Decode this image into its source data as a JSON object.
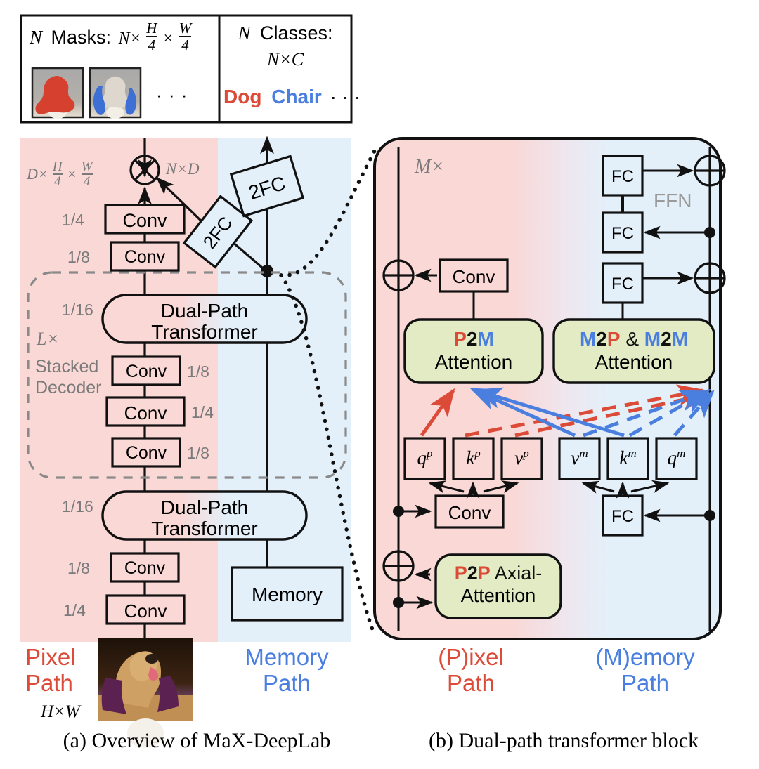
{
  "figure": {
    "captions": [
      {
        "id": "a",
        "text": "(a)  Overview of MaX-DeepLab"
      },
      {
        "id": "b",
        "text": "(b)  Dual-path transformer block"
      }
    ]
  },
  "colors": {
    "pixel_red": "#DC4A38",
    "memory_blue": "#4A7FE0",
    "pixel_bg": "#F9D8D6",
    "memory_bg": "#E3F0FA",
    "attention_green": "#E2EBC4",
    "gray_label": "#808080",
    "outline": "#111111"
  },
  "output_panel": {
    "masks": {
      "title_n": "N",
      "title_text": "Masks:",
      "shape_prefix": "N×",
      "frac1_num": "H",
      "frac1_den": "4",
      "times": "×",
      "frac2_num": "W",
      "frac2_den": "4",
      "ellipsis": "· · ·",
      "thumbs": [
        {
          "name": "mask-thumb-dog",
          "mask_color": "#D6402E"
        },
        {
          "name": "mask-thumb-chair",
          "mask_color": "#3E6FD4"
        }
      ]
    },
    "classes": {
      "title_n": "N",
      "title_text": "Classes:",
      "shape": "N×C",
      "labels": [
        {
          "text": "Dog",
          "color": "#DC4A38"
        },
        {
          "text": "Chair",
          "color": "#4A7FE0"
        }
      ],
      "ellipsis": "· · ·"
    }
  },
  "overview": {
    "path_labels": {
      "pixel": [
        "Pixel",
        "Path"
      ],
      "memory": [
        "Memory",
        "Path"
      ],
      "input_shape": "H×W"
    },
    "output_shape_left": {
      "prefix": "D×",
      "n1": "H",
      "d1": "4",
      "mid": "×",
      "n2": "W",
      "d2": "4"
    },
    "mul_out_label": "N×D",
    "multiply_symbol": "⊗",
    "fc_blocks": [
      {
        "name": "fc-2fc-mask",
        "label": "2FC"
      },
      {
        "name": "fc-2fc-class",
        "label": "2FC"
      }
    ],
    "dashed_group": {
      "repeat": "L×",
      "line1": "Stacked",
      "line2": "Decoder"
    },
    "transformer_label": [
      "Dual-Path",
      "Transformer"
    ],
    "memory_box_label": "Memory",
    "conv_label": "Conv",
    "stages": [
      {
        "name": "conv-top-1-4",
        "label": "Conv",
        "scale": "1/4",
        "scale_side": "left"
      },
      {
        "name": "conv-top-1-8",
        "label": "Conv",
        "scale": "1/8",
        "scale_side": "left"
      },
      {
        "name": "transformer-upper",
        "label": "Dual-Path Transformer",
        "scale": "1/16",
        "scale_side": "left"
      },
      {
        "name": "conv-dec-1-8a",
        "label": "Conv",
        "scale": "1/8",
        "scale_side": "right"
      },
      {
        "name": "conv-dec-1-4",
        "label": "Conv",
        "scale": "1/4",
        "scale_side": "right"
      },
      {
        "name": "conv-dec-1-8b",
        "label": "Conv",
        "scale": "1/8",
        "scale_side": "right"
      },
      {
        "name": "transformer-lower",
        "label": "Dual-Path Transformer",
        "scale": "1/16",
        "scale_side": "left"
      },
      {
        "name": "conv-bot-1-8",
        "label": "Conv",
        "scale": "1/8",
        "scale_side": "left"
      },
      {
        "name": "conv-bot-1-4",
        "label": "Conv",
        "scale": "1/4",
        "scale_side": "left"
      }
    ]
  },
  "block": {
    "repeat": "M×",
    "ffn_label": "FFN",
    "conv_label": "Conv",
    "fc_label": "FC",
    "path_labels": {
      "pixel_paren": "(P)",
      "pixel_rest": "ixel",
      "pixel_line2": "Path",
      "memory_paren": "(M)",
      "memory_rest": "emory",
      "memory_line2": "Path"
    },
    "attention_blocks": [
      {
        "name": "p2m-attention",
        "tokens": [
          {
            "t": "P",
            "c": "#DC4A38"
          },
          {
            "t": "2",
            "c": "#111111"
          },
          {
            "t": "M",
            "c": "#4A7FE0"
          }
        ],
        "line2": "Attention"
      },
      {
        "name": "m2p-m2m-attention",
        "tokens": [
          {
            "t": "M",
            "c": "#4A7FE0"
          },
          {
            "t": "2",
            "c": "#111111"
          },
          {
            "t": "P",
            "c": "#DC4A38"
          },
          {
            "t": " & ",
            "c": "#111111"
          },
          {
            "t": "M",
            "c": "#4A7FE0"
          },
          {
            "t": "2",
            "c": "#111111"
          },
          {
            "t": "M",
            "c": "#4A7FE0"
          }
        ],
        "line2": "Attention"
      },
      {
        "name": "p2p-axial-attention",
        "tokens": [
          {
            "t": "P",
            "c": "#DC4A38"
          },
          {
            "t": "2",
            "c": "#111111"
          },
          {
            "t": "P",
            "c": "#DC4A38"
          },
          {
            "t": " Axial-",
            "c": "#111111"
          }
        ],
        "line2": "Attention"
      }
    ],
    "qkv_pixel": [
      {
        "name": "qkv-qp",
        "base": "q",
        "sup": "p"
      },
      {
        "name": "qkv-kp",
        "base": "k",
        "sup": "p"
      },
      {
        "name": "qkv-vp",
        "base": "v",
        "sup": "p"
      }
    ],
    "qkv_memory": [
      {
        "name": "qkv-vm",
        "base": "v",
        "sup": "m"
      },
      {
        "name": "qkv-km",
        "base": "k",
        "sup": "m"
      },
      {
        "name": "qkv-qm",
        "base": "q",
        "sup": "m"
      }
    ],
    "fc_stack": [
      {
        "name": "fc-ffn-top",
        "label": "FC"
      },
      {
        "name": "fc-ffn-bottom",
        "label": "FC"
      },
      {
        "name": "fc-attn-out",
        "label": "FC"
      },
      {
        "name": "fc-qkv-proj",
        "label": "FC"
      }
    ],
    "conv_blocks": [
      {
        "name": "conv-attn-out",
        "label": "Conv"
      },
      {
        "name": "conv-qkv-proj",
        "label": "Conv"
      }
    ],
    "plus_symbol": "⊕"
  }
}
